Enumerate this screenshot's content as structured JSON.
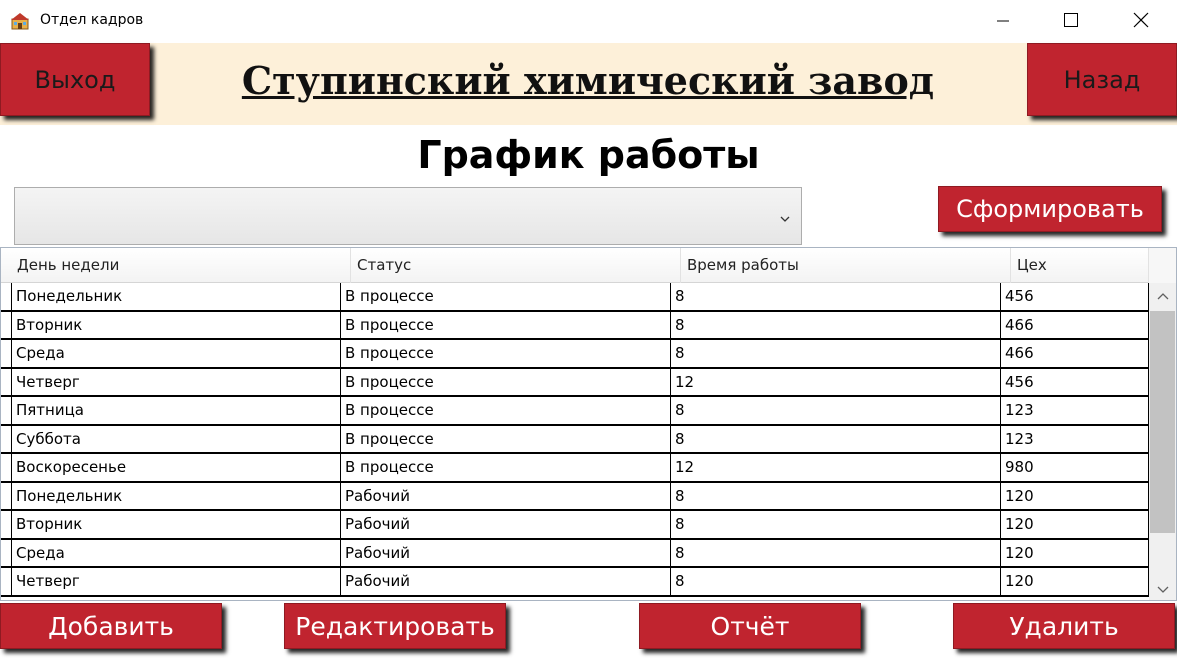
{
  "window": {
    "title": "Отдел кадров",
    "icon": "school-building-icon"
  },
  "header": {
    "company": "Ступинский химический завод",
    "exit_label": "Выход",
    "back_label": "Назад"
  },
  "section": {
    "title": "График работы"
  },
  "filter": {
    "selected": "",
    "generate_label": "Сформировать"
  },
  "table": {
    "columns": [
      "День недели",
      "Статус",
      "Время работы",
      "Цех"
    ],
    "rows": [
      [
        "Понедельник",
        "В процессе",
        "8",
        "456"
      ],
      [
        "Вторник",
        "В процессе",
        "8",
        "466"
      ],
      [
        "Среда",
        "В процессе",
        "8",
        "466"
      ],
      [
        "Четверг",
        "В процессе",
        "12",
        "456"
      ],
      [
        "Пятница",
        "В процессе",
        "8",
        "123"
      ],
      [
        "Суббота",
        "В процессе",
        "8",
        "123"
      ],
      [
        "Воскоресенье",
        "В процессе",
        "12",
        "980"
      ],
      [
        "Понедельник",
        "Рабочий",
        "8",
        "120"
      ],
      [
        "Вторник",
        "Рабочий",
        "8",
        "120"
      ],
      [
        "Среда",
        "Рабочий",
        "8",
        "120"
      ],
      [
        "Четверг",
        "Рабочий",
        "8",
        "120"
      ]
    ]
  },
  "actions": {
    "add_label": "Добавить",
    "edit_label": "Редактировать",
    "report_label": "Отчёт",
    "delete_label": "Удалить"
  },
  "colors": {
    "accent": "#c0242f",
    "header_band": "#fdf0d9"
  }
}
